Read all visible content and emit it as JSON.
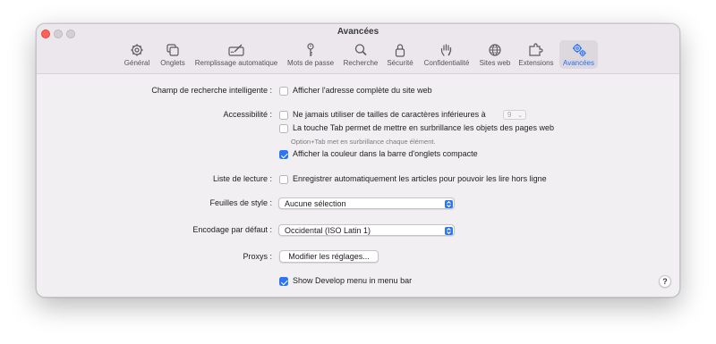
{
  "window": {
    "title": "Avancées"
  },
  "tabs": [
    {
      "label": "Général",
      "icon": "gear-icon"
    },
    {
      "label": "Onglets",
      "icon": "tabs-icon"
    },
    {
      "label": "Remplissage automatique",
      "icon": "autofill-pen-icon"
    },
    {
      "label": "Mots de passe",
      "icon": "key-icon"
    },
    {
      "label": "Recherche",
      "icon": "magnifier-icon"
    },
    {
      "label": "Sécurité",
      "icon": "lock-icon"
    },
    {
      "label": "Confidentialité",
      "icon": "hand-icon"
    },
    {
      "label": "Sites web",
      "icon": "globe-icon"
    },
    {
      "label": "Extensions",
      "icon": "puzzle-icon"
    },
    {
      "label": "Avancées",
      "icon": "gears-icon",
      "active": true
    }
  ],
  "settings": {
    "smart_search": {
      "label": "Champ de recherche intelligente :",
      "option": "Afficher l'adresse complète du site web",
      "checked": false
    },
    "accessibility": {
      "label": "Accessibilité :",
      "min_font_option": "Ne jamais utiliser de tailles de caractères inférieures à",
      "min_font_value": "9",
      "min_font_checked": false,
      "tab_option": "La touche Tab permet de mettre en surbrillance les objets des pages web",
      "tab_checked": false,
      "tab_hint": "Option+Tab met en surbrillance chaque élément.",
      "color_option": "Afficher la couleur dans la barre d'onglets compacte",
      "color_checked": true
    },
    "reading_list": {
      "label": "Liste de lecture :",
      "option": "Enregistrer automatiquement les articles pour pouvoir les lire hors ligne",
      "checked": false
    },
    "stylesheet": {
      "label": "Feuilles de style :",
      "value": "Aucune sélection"
    },
    "encoding": {
      "label": "Encodage par défaut :",
      "value": "Occidental (ISO Latin 1)"
    },
    "proxies": {
      "label": "Proxys :",
      "button": "Modifier les réglages..."
    },
    "develop": {
      "option": "Show Develop menu in menu bar",
      "checked": true
    }
  },
  "help": {
    "label": "?"
  },
  "colors": {
    "accent": "#2b75f6",
    "close": "#fe5f57"
  }
}
